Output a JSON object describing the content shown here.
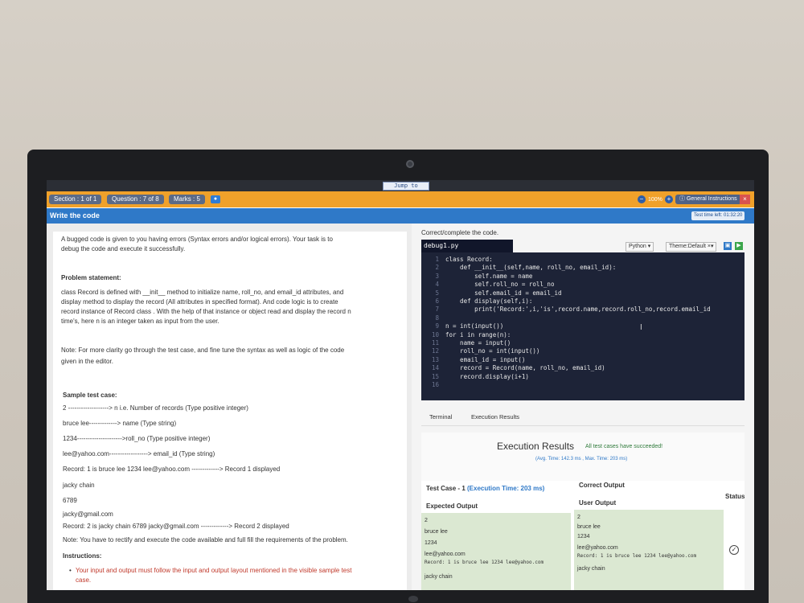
{
  "header": {
    "jump_to": "Jump to",
    "section": "Section : 1 of 1",
    "question": "Question : 7 of 8",
    "marks": "Marks : 5",
    "zoom": "100%",
    "general_instructions": "General Instructions",
    "close": "×",
    "page_title": "Write the code",
    "time_left": "Test time left: 01:32:20"
  },
  "problem": {
    "intro_1": "A bugged code is given to you having errors (Syntax errors and/or logical errors). Your task is to",
    "intro_2": "debug the code and execute it successfully.",
    "statement_heading": "Problem statement:",
    "statement_1": "class Record is defined with __init__ method to initialize name, roll_no, and email_id attributes, and",
    "statement_2": "display method to display the record (All attributes in specified format). And code logic is to create",
    "statement_3": "record instance of Record class . With the help of that instance or object read and display the record n",
    "statement_4": "time's, here n is an integer taken as input from the user.",
    "note_1": "Note: For more clarity go through the test case, and fine tune the syntax as well as logic of the code",
    "note_2": "given in the editor.",
    "sample_heading": "Sample test case:",
    "sample_lines": [
      "2 -------------------> n i.e. Number of records (Type positive integer)",
      "bruce lee-------------> name (Type string)",
      "1234--------------------->roll_no (Type positive integer)",
      "lee@yahoo.com------------------> email_id (Type string)",
      "Record: 1 is bruce lee 1234 lee@yahoo.com -------------> Record 1 displayed",
      "jacky chain",
      "6789",
      "jacky@gmail.com",
      "Record: 2 is jacky chain 6789 jacky@gmail.com -------------> Record 2 displayed"
    ],
    "note_rectify": "Note: You have to rectify and execute the code available and full fill the requirements of the problem.",
    "instructions_heading": "Instructions:",
    "instruction_1": "Your input and output must follow the input and output layout mentioned in the visible sample test",
    "instruction_1b": "case."
  },
  "editor": {
    "heading": "Correct/complete the code.",
    "filename": "debug1.py",
    "language": "Python",
    "theme": "Theme:Default",
    "lines": [
      "class Record:",
      "    def __init__(self,name, roll_no, email_id):",
      "        self.name = name",
      "        self.roll_no = roll_no",
      "        self.email_id = email_id",
      "    def display(self,i):",
      "        print('Record:',i,'is',record.name,record.roll_no,record.email_id",
      "",
      "n = int(input())",
      "for i in range(n):",
      "    name = input()",
      "    roll_no = int(input())",
      "    email_id = input()",
      "    record = Record(name, roll_no, email_id)",
      "    record.display(i+1)",
      ""
    ],
    "line_numbers": [
      "1",
      "2",
      "3",
      "4",
      "5",
      "6",
      "7",
      "8",
      "9",
      "10",
      "11",
      "12",
      "13",
      "14",
      "15",
      "16"
    ]
  },
  "tabs": {
    "terminal": "Terminal",
    "execution_results": "Execution Results"
  },
  "results": {
    "title": "Execution Results",
    "status": "All test cases have succeeded!",
    "timing": "(Avg. Time: 142.3 ms , Max. Time: 203 ms)",
    "test_case_label": "Test Case - 1",
    "exec_time": "(Execution Time: 203 ms)",
    "correct_output": "Correct Output",
    "status_col": "Status",
    "expected_output": "Expected Output",
    "user_output": "User Output",
    "expected_lines": [
      "2",
      "bruce lee",
      "1234",
      "lee@yahoo.com",
      "Record: 1 is bruce lee 1234 lee@yahoo.com",
      "jacky chain"
    ],
    "user_lines": [
      "2",
      "bruce lee",
      "1234",
      "lee@yahoo.com",
      "Record: 1 is bruce lee 1234 lee@yahoo.com",
      "jacky chain"
    ]
  }
}
